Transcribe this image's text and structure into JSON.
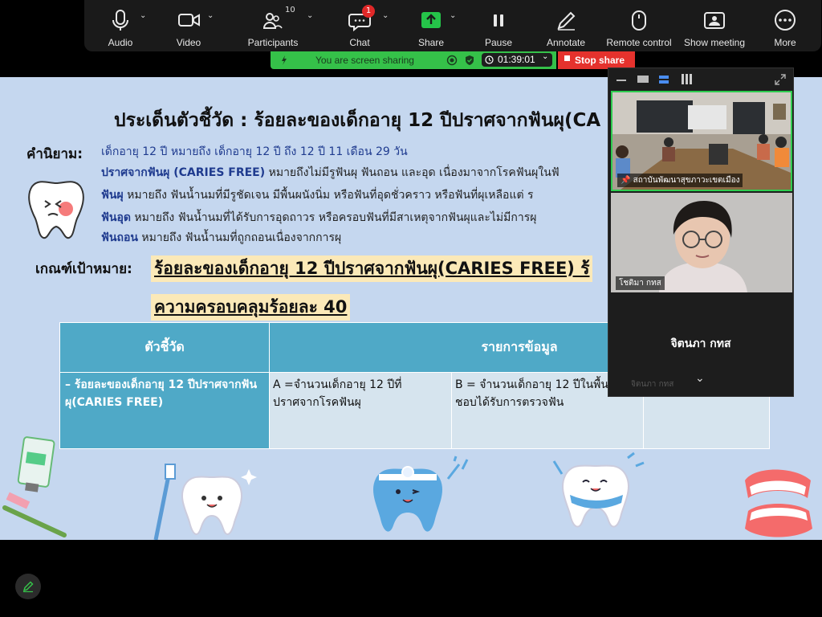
{
  "toolbar": {
    "items": [
      {
        "label": "Audio",
        "icon": "microphone-icon"
      },
      {
        "label": "Video",
        "icon": "video-camera-icon"
      },
      {
        "label": "Participants",
        "icon": "participants-icon",
        "count": "10"
      },
      {
        "label": "Chat",
        "icon": "chat-icon",
        "badge": "1"
      },
      {
        "label": "Share",
        "icon": "share-arrow-icon"
      },
      {
        "label": "Pause",
        "icon": "pause-icon"
      },
      {
        "label": "Annotate",
        "icon": "pencil-icon"
      },
      {
        "label": "Remote control",
        "icon": "mouse-icon"
      },
      {
        "label": "Show meeting",
        "icon": "show-meeting-icon"
      },
      {
        "label": "More",
        "icon": "more-dots-icon"
      }
    ]
  },
  "share_bar": {
    "status": "You are screen sharing",
    "timer": "01:39:01",
    "stop_label": "Stop share",
    "color": "#35c149",
    "stop_color": "#e5322d"
  },
  "slide": {
    "title": "ประเด็นตัวชี้วัด : ร้อยละของเด็กอายุ 12 ปีปราศจากฟันผุ(CA",
    "definition_label": "คำนิยาม:",
    "def1_a": "เด็กอายุ 12 ปี หมายถึง ",
    "def1_b": "เด็กอายุ 12 ปี ถึง 12 ปี 11 เดือน 29 วัน",
    "def2_a": "ปราศจากฟันผุ (CARIES FREE)",
    "def2_b": "  หมายถึงไม่มีรูฟันผุ ฟันถอน และอุด เนื่องมาจากโรคฟันผุในฟั",
    "def3_a": "ฟันผุ",
    "def3_b": " หมายถึง ฟันน้ำนมที่มีรูชัดเจน มีพื้นผนังนิ่ม หรือฟันที่อุดชั่วคราว หรือฟันที่ผุเหลือแต่ ร",
    "def4_a": "ฟันอุด",
    "def4_b": " หมายถึง ฟันน้ำนมที่ได้รับการอุดถาวร หรือครอบฟันที่มีสาเหตุจากฟันผุและไม่มีการผุ",
    "def5_a": "ฟันถอน",
    "def5_b": " หมายถึง ฟันน้ำนมที่ถูกถอนเนื่องจากการผุ",
    "target_label": "เกณฑ์เป้าหมาย:",
    "target_line1": "ร้อยละของเด็กอายุ 12 ปีปราศจากฟันผุ(CARIES FREE) ร้",
    "target_line2": " ความครอบคลุมร้อยละ 40",
    "table": {
      "headers": [
        "ตัวชี้วัด",
        "รายการข้อมูล"
      ],
      "row": [
        "– ร้อยละของเด็กอายุ 12 ปีปราศจากฟันผุ(CARIES FREE)",
        "A =จำนวนเด็กอายุ 12 ปีที่ปราศจากโรคฟันผุ",
        "B = จำนวนเด็กอายุ 12 ปีในพื้นรับผิดชอบได้รับการตรวจฟัน",
        ""
      ]
    }
  },
  "video_panel": {
    "tile1_name": "สถาบันพัฒนาสุขภาวะเขตเมือง",
    "tile2_name": "โชติมา กทส",
    "active_speaker": "จิตนภา กทส",
    "ghost_name": "จิตนภา กทส"
  }
}
